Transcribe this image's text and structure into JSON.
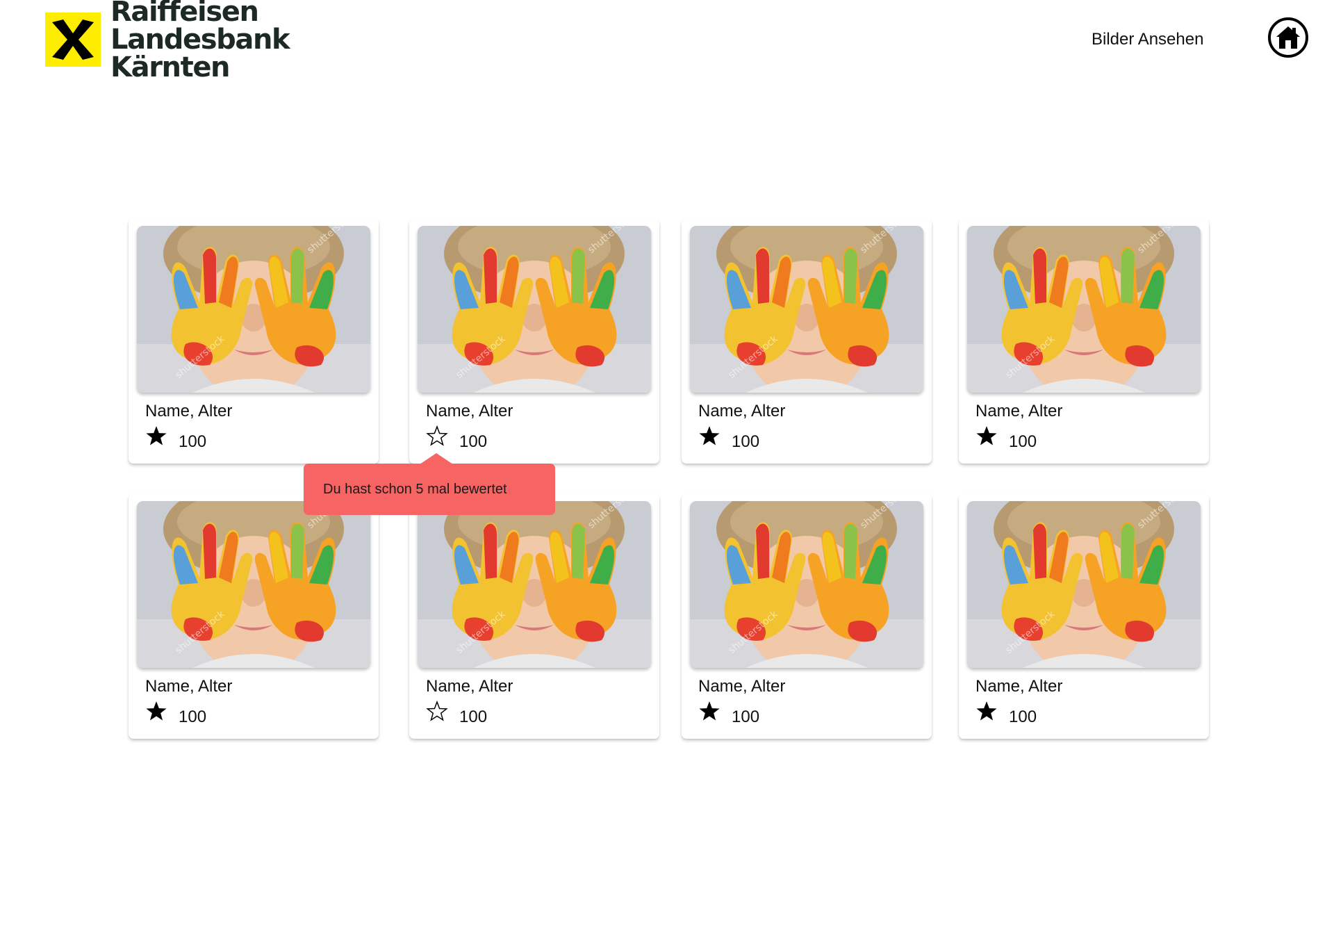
{
  "header": {
    "logo": {
      "line1": "Raiffeisen",
      "line2": "Landesbank Kärnten",
      "brand_color": "#FFED00"
    },
    "nav_link": "Bilder Ansehen",
    "home_icon": "home-icon"
  },
  "cards": [
    {
      "name": "Name, Alter",
      "score": "100",
      "star": "filled"
    },
    {
      "name": "Name, Alter",
      "score": "100",
      "star": "outline"
    },
    {
      "name": "Name, Alter",
      "score": "100",
      "star": "filled"
    },
    {
      "name": "Name, Alter",
      "score": "100",
      "star": "filled"
    },
    {
      "name": "Name, Alter",
      "score": "100",
      "star": "filled"
    },
    {
      "name": "Name, Alter",
      "score": "100",
      "star": "outline"
    },
    {
      "name": "Name, Alter",
      "score": "100",
      "star": "filled"
    },
    {
      "name": "Name, Alter",
      "score": "100",
      "star": "filled"
    }
  ],
  "tooltip": {
    "text": "Du hast schon 5 mal bewertet",
    "color": "#F76464"
  }
}
